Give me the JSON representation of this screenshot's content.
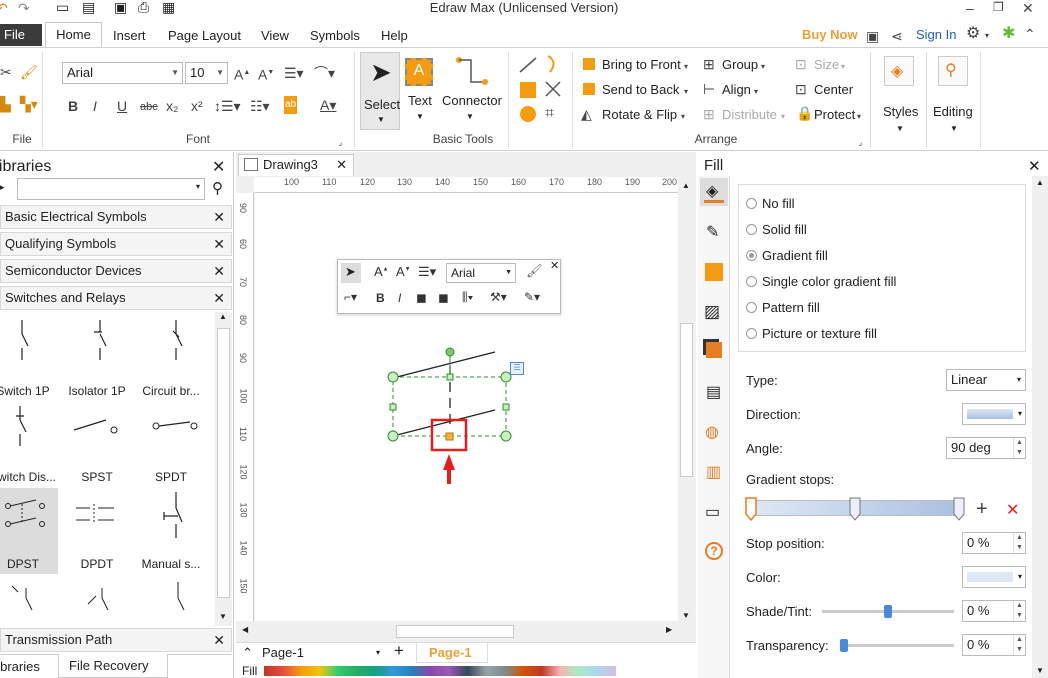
{
  "window": {
    "title": "Edraw Max (Unlicensed Version)",
    "min": "–",
    "restore": "❐",
    "close": "✕"
  },
  "tabs": {
    "file": "File",
    "home": "Home",
    "insert": "Insert",
    "page_layout": "Page Layout",
    "view": "View",
    "symbols": "Symbols",
    "help": "Help"
  },
  "account": {
    "buy_now": "Buy Now",
    "sign_in": "Sign In"
  },
  "ribbon": {
    "font_name": "Arial",
    "font_size": "10",
    "groups": {
      "file": "File",
      "font": "Font",
      "basic_tools": "Basic Tools",
      "arrange": "Arrange"
    },
    "tools": {
      "select": "Select",
      "text": "Text",
      "connector": "Connector"
    },
    "arrange": {
      "bring_front": "Bring to Front",
      "send_back": "Send to Back",
      "rotate_flip": "Rotate & Flip",
      "group": "Group",
      "align": "Align",
      "distribute": "Distribute",
      "size": "Size",
      "center": "Center",
      "protect": "Protect"
    },
    "styles": "Styles",
    "editing": "Editing"
  },
  "libraries": {
    "title": "Libraries",
    "items": [
      "Basic Electrical Symbols",
      "Qualifying Symbols",
      "Semiconductor Devices",
      "Switches and Relays"
    ],
    "shapes": [
      "Switch 1P",
      "Isolator 1P",
      "Circuit br...",
      "Switch Dis...",
      "SPST",
      "SPDT",
      "DPST",
      "DPDT",
      "Manual s..."
    ],
    "bottom_item": "Transmission Path",
    "bottom_tabs": [
      "Libraries",
      "File Recovery"
    ]
  },
  "document": {
    "tab": "Drawing3",
    "ruler_h": [
      "100",
      "110",
      "120",
      "130",
      "140",
      "150",
      "160",
      "170",
      "180",
      "190",
      "200"
    ],
    "ruler_v": [
      "90",
      "60",
      "70",
      "80",
      "90",
      "100",
      "110",
      "120",
      "130",
      "140",
      "150"
    ],
    "floating_font": "Arial",
    "page_select": "Page-1",
    "page_tab": "Page-1",
    "fill_label": "Fill"
  },
  "fill": {
    "title": "Fill",
    "options": [
      "No fill",
      "Solid fill",
      "Gradient fill",
      "Single color gradient fill",
      "Pattern fill",
      "Picture or texture fill"
    ],
    "selected": "Gradient fill",
    "type_label": "Type:",
    "type_value": "Linear",
    "direction_label": "Direction:",
    "angle_label": "Angle:",
    "angle_value": "90 deg",
    "stops_label": "Gradient stops:",
    "stop_pos_label": "Stop position:",
    "stop_pos_value": "0 %",
    "color_label": "Color:",
    "shade_label": "Shade/Tint:",
    "shade_value": "0 %",
    "transparency_label": "Transparency:",
    "transparency_value": "0 %"
  },
  "colors": {
    "accent_orange": "#f39c12",
    "buy_now": "#e8a23a",
    "gradient_light": "#dfe8f4",
    "gradient_dark": "#a9c0e0",
    "selection": "#2e8b2e",
    "highlight": "#e02020"
  }
}
